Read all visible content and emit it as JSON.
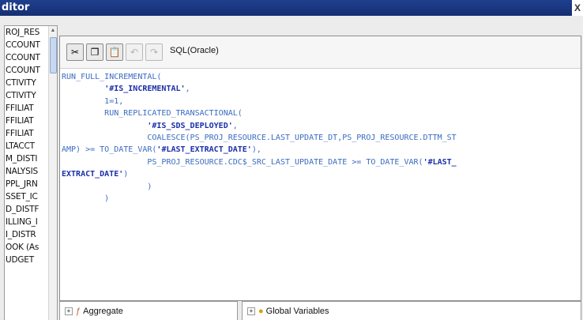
{
  "window": {
    "title": "ditor",
    "close_label": "X"
  },
  "left_list": {
    "items": [
      "ROJ_RES",
      "CCOUNT",
      "CCOUNT",
      "CCOUNT",
      "CTIVITY",
      "CTIVITY",
      "FFILIAT",
      "FFILIAT",
      "FFILIAT",
      "LTACCT",
      "M_DISTI",
      "NALYSIS",
      "PPL_JRN",
      "SSET_IC",
      "D_DISTF",
      "ILLING_I",
      "I_DISTR",
      "OOK (As",
      "UDGET"
    ]
  },
  "toolbar": {
    "language_label": "SQL(Oracle)",
    "icons": [
      "cut-icon",
      "copy-icon",
      "paste-icon",
      "undo-icon",
      "redo-icon"
    ]
  },
  "code_lines": [
    {
      "text": "RUN_FULL_INCREMENTAL("
    },
    {
      "indent": "         ",
      "str": "'#IS_INCREMENTAL'",
      "after": ","
    },
    {
      "text": "         1=1,"
    },
    {
      "text": "         RUN_REPLICATED_TRANSACTIONAL("
    },
    {
      "indent": "                  ",
      "str": "'#IS_SDS_DEPLOYED'",
      "after": ","
    },
    {
      "text": "                  COALESCE(PS_PROJ_RESOURCE.LAST_UPDATE_DT,PS_PROJ_RESOURCE.DTTM_ST"
    },
    {
      "before": "AMP) >= TO_DATE_VAR(",
      "str": "'#LAST_EXTRACT_DATE'",
      "after": "),"
    },
    {
      "before": "                  PS_PROJ_RESOURCE.CDC$_SRC_LAST_UPDATE_DATE >= TO_DATE_VAR(",
      "str": "'#LAST_"
    },
    {
      "str": "EXTRACT_DATE'",
      "after": ")"
    },
    {
      "text": "                  )"
    },
    {
      "text": "         )"
    }
  ],
  "bottom": {
    "left_node": "Aggregate",
    "right_node": "Global Variables",
    "expand_symbol": "+"
  }
}
